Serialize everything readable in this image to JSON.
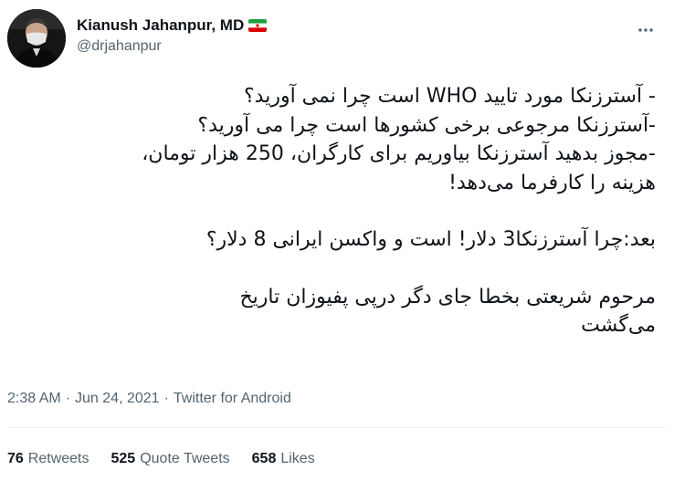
{
  "author": {
    "display_name": "Kianush Jahanpur, MD",
    "handle": "@drjahanpur",
    "flag_icon": "iran-flag-icon"
  },
  "tweet": {
    "lines": [
      "- آسترزنکا مورد تایید WHO است چرا نمی آورید؟",
      "-آسترزنکا مرجوعی برخی کشورها است چرا می آورید؟",
      "-مجوز بدهید آسترزنکا بیاوریم برای کارگران، 250 هزار تومان،",
      "هزینه را کارفرما می‌دهد!",
      "",
      "بعد:چرا آسترزنکا3 دلار! است و واکسن ایرانی 8 دلار؟",
      "",
      "مرحوم شریعتی بخطا جای دگر درپی پفیوزان تاریخ",
      "می‌گشت"
    ],
    "time": "2:38 AM",
    "date": "Jun 24, 2021",
    "source": "Twitter for Android",
    "separator": "·"
  },
  "stats": {
    "retweets_count": "76",
    "retweets_label": "Retweets",
    "quote_tweets_count": "525",
    "quote_tweets_label": "Quote Tweets",
    "likes_count": "658",
    "likes_label": "Likes"
  },
  "colors": {
    "text": "#0f1419",
    "secondary": "#536471",
    "divider": "#eff3f4"
  }
}
